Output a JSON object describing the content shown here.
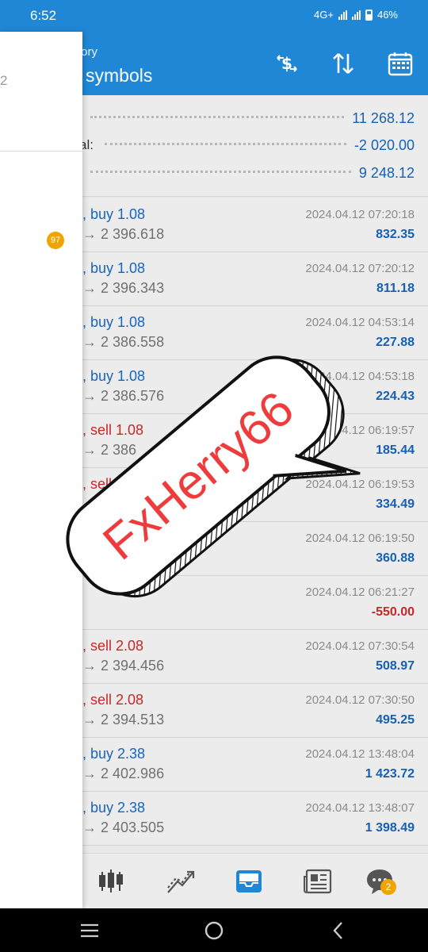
{
  "status": {
    "time": "6:52",
    "network": "4G+",
    "battery": "46%"
  },
  "appbar": {
    "subtitle": "tory",
    "title": "symbols",
    "icons": [
      "dollar-exchange-icon",
      "sort-icon",
      "calendar-icon"
    ]
  },
  "drawer": {
    "fragment": "2",
    "badge": "97"
  },
  "summary": [
    {
      "label": "",
      "value": "11 268.12"
    },
    {
      "label": "al:",
      "value": "-2 020.00"
    },
    {
      "label": "",
      "value": "9 248.12"
    }
  ],
  "deals": [
    {
      "type": "buy",
      "type_text": "buy 1.08",
      "price": "→ 2 396.618",
      "time": "2024.04.12 07:20:18",
      "profit": "832.35"
    },
    {
      "type": "buy",
      "type_text": "buy 1.08",
      "price": "→ 2 396.343",
      "time": "2024.04.12 07:20:12",
      "profit": "811.18"
    },
    {
      "type": "buy",
      "type_text": "buy 1.08",
      "price": "→ 2 386.558",
      "time": "2024.04.12 04:53:14",
      "profit": "227.88"
    },
    {
      "type": "buy",
      "type_text": "buy 1.08",
      "price": "→ 2 386.576",
      "time": "2024.04.12 04:53:18",
      "profit": "224.43"
    },
    {
      "type": "sell",
      "type_text": "sell 1.08",
      "price": "→ 2 386",
      "time": "2024.04.12 06:19:57",
      "profit": "185.44"
    },
    {
      "type": "sell",
      "type_text": "sell",
      "price": "",
      "time": "2024.04.12 06:19:53",
      "profit": "334.49"
    },
    {
      "type": "sell",
      "type_text": "",
      "price": "",
      "time": "2024.04.12 06:19:50",
      "profit": "360.88"
    },
    {
      "type": "sell",
      "type_text": "",
      "price": "",
      "time": "2024.04.12 06:21:27",
      "profit": "-550.00"
    },
    {
      "type": "sell",
      "type_text": "sell 2.08",
      "price": "→ 2 394.456",
      "time": "2024.04.12 07:30:54",
      "profit": "508.97"
    },
    {
      "type": "sell",
      "type_text": "sell 2.08",
      "price": "→ 2 394.513",
      "time": "2024.04.12 07:30:50",
      "profit": "495.25"
    },
    {
      "type": "buy",
      "type_text": "buy 2.38",
      "price": "→ 2 402.986",
      "time": "2024.04.12 13:48:04",
      "profit": "1 423.72"
    },
    {
      "type": "buy",
      "type_text": "buy 2.38",
      "price": "→ 2 403.505",
      "time": "2024.04.12 13:48:07",
      "profit": "1 398.49"
    }
  ],
  "bottom_nav": {
    "items": [
      "quotes-icon",
      "chart-icon",
      "history-icon",
      "news-icon",
      "chat-icon"
    ],
    "active": "history-icon",
    "chat_badge": "2"
  },
  "watermark": {
    "text": "FxHerry66"
  },
  "colors": {
    "accent": "#1f87d6",
    "profit_positive": "#1560b5",
    "profit_negative": "#c62828",
    "badge": "#f0a400"
  }
}
